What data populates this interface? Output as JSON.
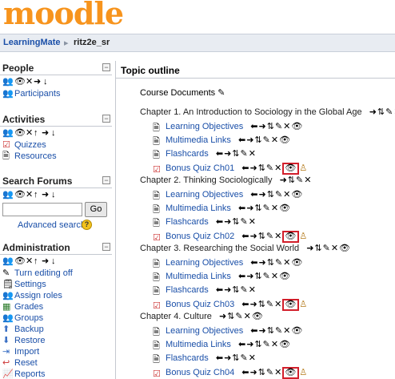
{
  "header": {
    "logo_text": "moodle"
  },
  "navbar": {
    "home": "LearningMate",
    "separator": "▸",
    "course": "ritz2e_sr"
  },
  "blocks": {
    "people": {
      "title": "People",
      "edit_icons": "✕✚✦",
      "items": [
        {
          "label": "Participants",
          "icon": "people-icon"
        }
      ]
    },
    "activities": {
      "title": "Activities",
      "edit_icons": "✕✚✦",
      "items": [
        {
          "label": "Quizzes",
          "icon": "quiz-icon"
        },
        {
          "label": "Resources",
          "icon": "resource-icon"
        }
      ]
    },
    "search": {
      "title": "Search Forums",
      "go_label": "Go",
      "advanced_label": "Advanced search",
      "input_value": ""
    },
    "admin": {
      "title": "Administration",
      "items": [
        {
          "label": "Turn editing off",
          "icon": "edit-icon"
        },
        {
          "label": "Settings",
          "icon": "settings-icon"
        },
        {
          "label": "Assign roles",
          "icon": "roles-icon"
        },
        {
          "label": "Grades",
          "icon": "grades-icon"
        },
        {
          "label": "Groups",
          "icon": "groups-icon"
        },
        {
          "label": "Backup",
          "icon": "backup-icon"
        },
        {
          "label": "Restore",
          "icon": "restore-icon"
        },
        {
          "label": "Import",
          "icon": "import-icon"
        },
        {
          "label": "Reset",
          "icon": "reset-icon"
        },
        {
          "label": "Reports",
          "icon": "reports-icon"
        }
      ]
    }
  },
  "main": {
    "title": "Topic outline",
    "course_docs": "Course Documents",
    "chapters": [
      {
        "title": "Chapter 1. An Introduction to Sociology in the Global Age",
        "items": [
          "Learning Objectives",
          "Multimedia Links",
          "Flashcards",
          "Bonus Quiz Ch01"
        ]
      },
      {
        "title": "Chapter 2. Thinking Sociologically",
        "items": [
          "Learning Objectives",
          "Multimedia Links",
          "Flashcards",
          "Bonus Quiz Ch02"
        ]
      },
      {
        "title": "Chapter 3. Researching the Social World",
        "items": [
          "Learning Objectives",
          "Multimedia Links",
          "Flashcards",
          "Bonus Quiz Ch03"
        ]
      },
      {
        "title": "Chapter 4. Culture",
        "items": [
          "Learning Objectives",
          "Multimedia Links",
          "Flashcards",
          "Bonus Quiz Ch04"
        ]
      }
    ]
  },
  "colors": {
    "link": "#1a4fa8",
    "highlight_box": "#d21f2b",
    "logo": "#f7941d"
  }
}
